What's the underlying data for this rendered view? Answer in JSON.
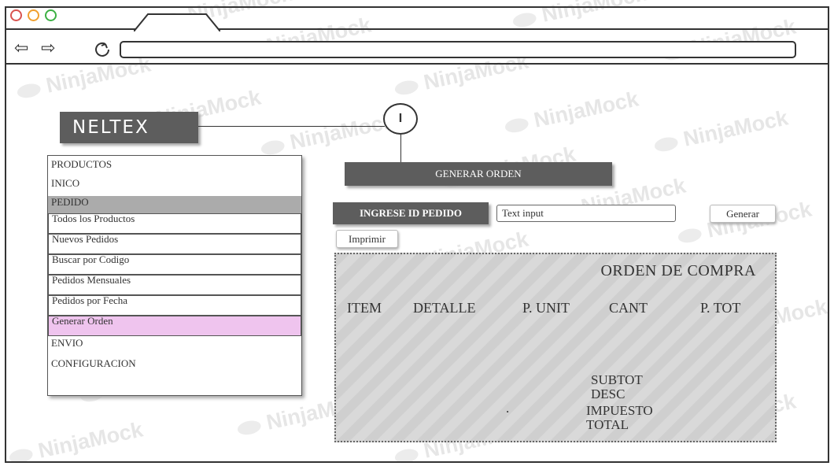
{
  "brand": {
    "logo_text": "NELTEX",
    "watermark": "NinjaMock"
  },
  "browser": {
    "url": ""
  },
  "step_marker": {
    "label": "I"
  },
  "sidebar": {
    "productos": "PRODUCTOS",
    "inicio": "INICO",
    "pedido": "PEDIDO",
    "sub_items": [
      "Todos los Productos",
      "Nuevos Pedidos",
      "Buscar por Codigo",
      "Pedidos Mensuales",
      "Pedidos por Fecha",
      "Generar Orden"
    ],
    "envio": "ENVIO",
    "configuracion": "CONFIGURACION"
  },
  "main": {
    "generar_orden": "GENERAR ORDEN",
    "ingrese_label": "INGRESE ID PEDIDO",
    "input_value": "Text input",
    "generar_button": "Generar",
    "imprimir_button": "Imprimir"
  },
  "orden": {
    "title": "ORDEN DE COMPRA",
    "columns": [
      "ITEM",
      "DETALLE",
      "P. UNIT",
      "CANT",
      "P. TOT"
    ],
    "subtot": "SUBTOT",
    "desc": "DESC",
    "impuesto": "IMPUESTO",
    "total": "TOTAL",
    "dot": "."
  },
  "colors": {
    "dark_button": "#5d5d5d",
    "active_item": "#efc4ee",
    "pedido_bg": "#ababab"
  }
}
